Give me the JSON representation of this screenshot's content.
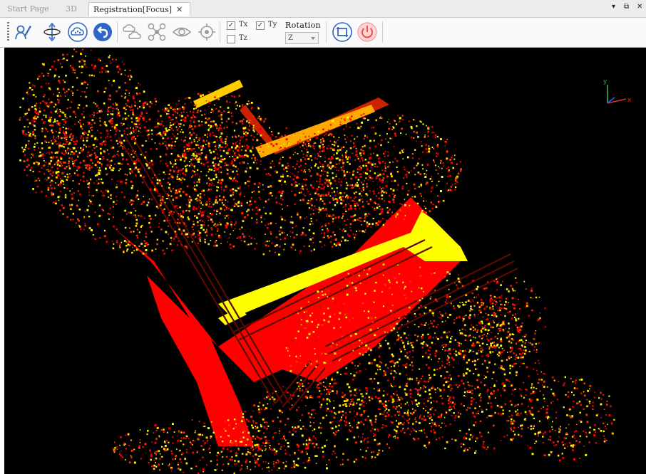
{
  "tabs": [
    {
      "label": "Start Page",
      "active": false
    },
    {
      "label": "3D",
      "active": false
    },
    {
      "label": "Registration[Focus]",
      "active": true
    }
  ],
  "window_controls": {
    "dropdown": "▾",
    "restore": "⧉",
    "close": "✕"
  },
  "toolbar": {
    "tx": {
      "label": "Tx",
      "checked": true
    },
    "ty": {
      "label": "Ty",
      "checked": true
    },
    "tz": {
      "label": "Tz",
      "checked": false
    },
    "rotation_label": "Rotation",
    "rotation_value": "Z"
  },
  "axes": {
    "x": "x",
    "y": "y"
  },
  "colors": {
    "ground": "#ff0000",
    "canopy": "#ffff00",
    "points_dark": "#cc1000",
    "background": "#000000"
  }
}
